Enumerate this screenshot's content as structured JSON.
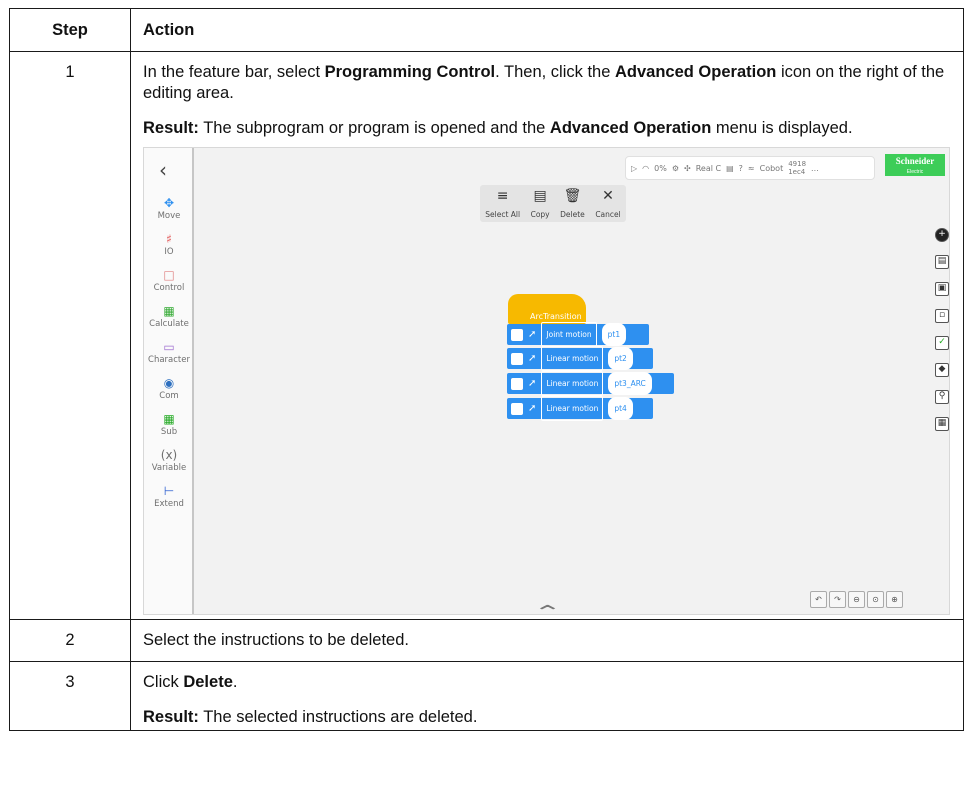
{
  "headers": {
    "step": "Step",
    "action": "Action"
  },
  "rows": [
    {
      "step": "1",
      "line1_a": "In the feature bar, select ",
      "line1_b": "Programming Control",
      "line1_c": ". Then, click the ",
      "line1_d": "Advanced Operation",
      "line1_e": " icon on the right of the editing area.",
      "result_label": "Result:",
      "result_a": " The subprogram or program is opened and the ",
      "result_b": "Advanced Operation",
      "result_c": " menu is displayed."
    },
    {
      "step": "2",
      "text": "Select the instructions to be deleted."
    },
    {
      "step": "3",
      "text_a": "Click ",
      "text_b": "Delete",
      "text_c": ".",
      "result_label": "Result:",
      "result_text": " The selected instructions are deleted."
    }
  ],
  "screenshot": {
    "sidebar": [
      "Move",
      "IO",
      "Control",
      "Calculate",
      "Character",
      "Com",
      "Sub",
      "Variable",
      "Extend"
    ],
    "topbar": {
      "percent": "0%",
      "real": "Real C",
      "cobot": "Cobot",
      "id_top": "4918",
      "id_bottom": "1ec4",
      "more": "..."
    },
    "logo": {
      "name": "Schneider",
      "sub": "Electric"
    },
    "toolbar": [
      "Select All",
      "Copy",
      "Delete",
      "Cancel"
    ],
    "block_title": "ArcTransition",
    "blocks": [
      {
        "motion": "Joint motion",
        "point": "pt1"
      },
      {
        "motion": "Linear motion",
        "point": "pt2"
      },
      {
        "motion": "Linear motion",
        "point": "pt3_ARC"
      },
      {
        "motion": "Linear motion",
        "point": "pt4"
      }
    ]
  }
}
